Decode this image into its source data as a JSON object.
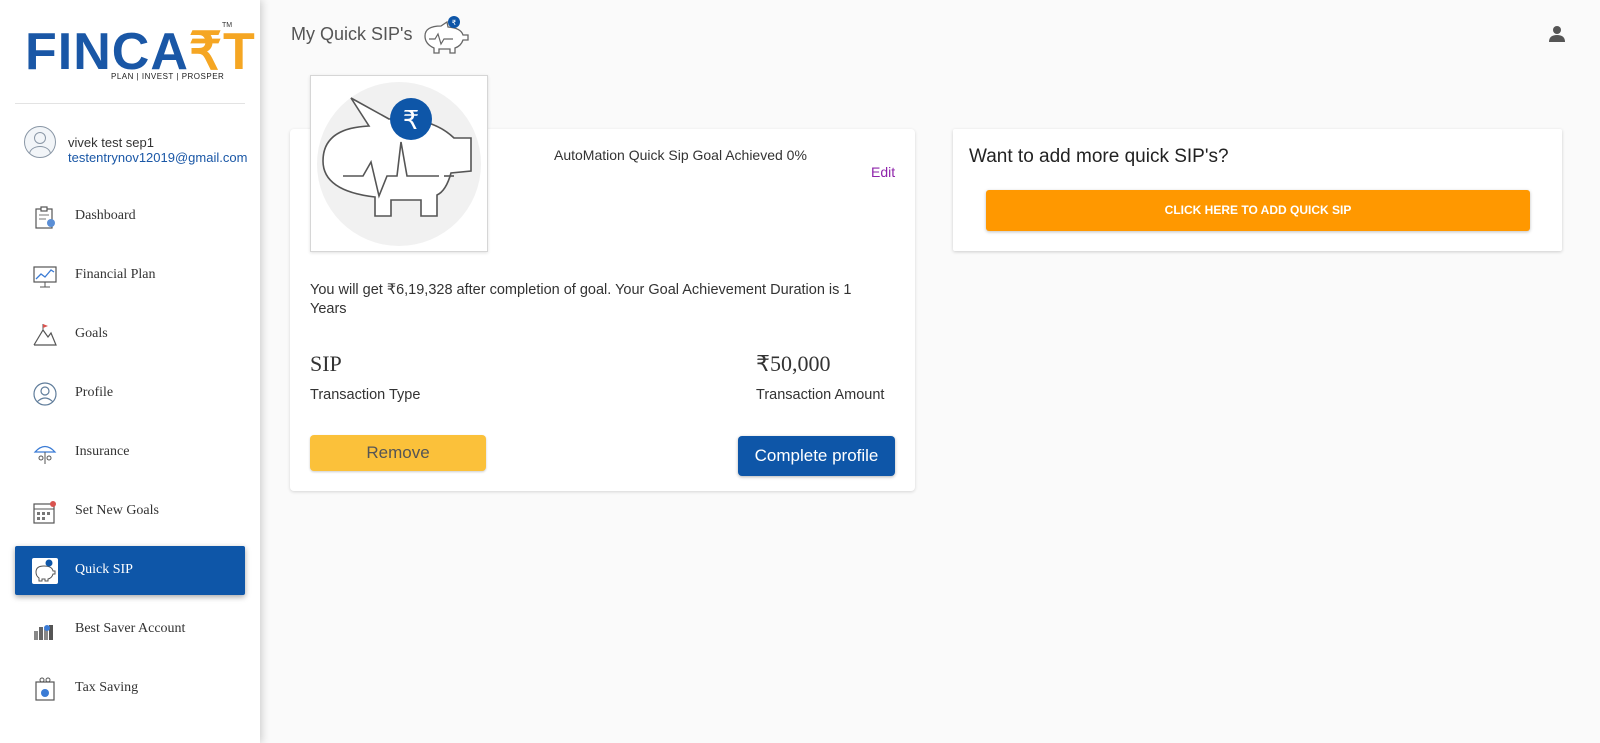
{
  "brand": {
    "logo_text_1": "FINCA",
    "logo_text_2": "₹T",
    "tm": "TM",
    "tagline": "PLAN | INVEST | PROSPER"
  },
  "user": {
    "name": "vivek test sep1",
    "email": "testentrynov12019@gmail.com"
  },
  "sidebar": {
    "items": [
      {
        "label": "Dashboard",
        "icon": "dashboard-icon"
      },
      {
        "label": "Financial Plan",
        "icon": "chart-icon"
      },
      {
        "label": "Goals",
        "icon": "mountain-flag-icon"
      },
      {
        "label": "Profile",
        "icon": "profile-icon"
      },
      {
        "label": "Insurance",
        "icon": "umbrella-icon"
      },
      {
        "label": "Set New Goals",
        "icon": "calendar-icon"
      },
      {
        "label": "Quick SIP",
        "icon": "piggy-bank-icon",
        "active": true
      },
      {
        "label": "Best Saver Account",
        "icon": "city-icon"
      },
      {
        "label": "Tax Saving",
        "icon": "tax-icon"
      }
    ]
  },
  "header": {
    "title": "My Quick SIP's"
  },
  "sip_card": {
    "goal_title": "AutoMation Quick Sip Goal Achieved 0%",
    "edit_label": "Edit",
    "description": "You will get ₹6,19,328 after completion of goal. Your Goal Achievement Duration is 1 Years",
    "transaction_type_value": "SIP",
    "transaction_type_label": "Transaction Type",
    "transaction_amount_value": "₹50,000",
    "transaction_amount_label": "Transaction Amount",
    "remove_label": "Remove",
    "complete_label": "Complete profile"
  },
  "add_card": {
    "title": "Want to add more quick SIP's?",
    "button_label": "CLICK HERE TO ADD QUICK SIP"
  },
  "colors": {
    "primary": "#0e56a8",
    "accent_orange": "#ff9800",
    "remove_yellow": "#fbc13a",
    "edit_purple": "#8e24aa"
  }
}
